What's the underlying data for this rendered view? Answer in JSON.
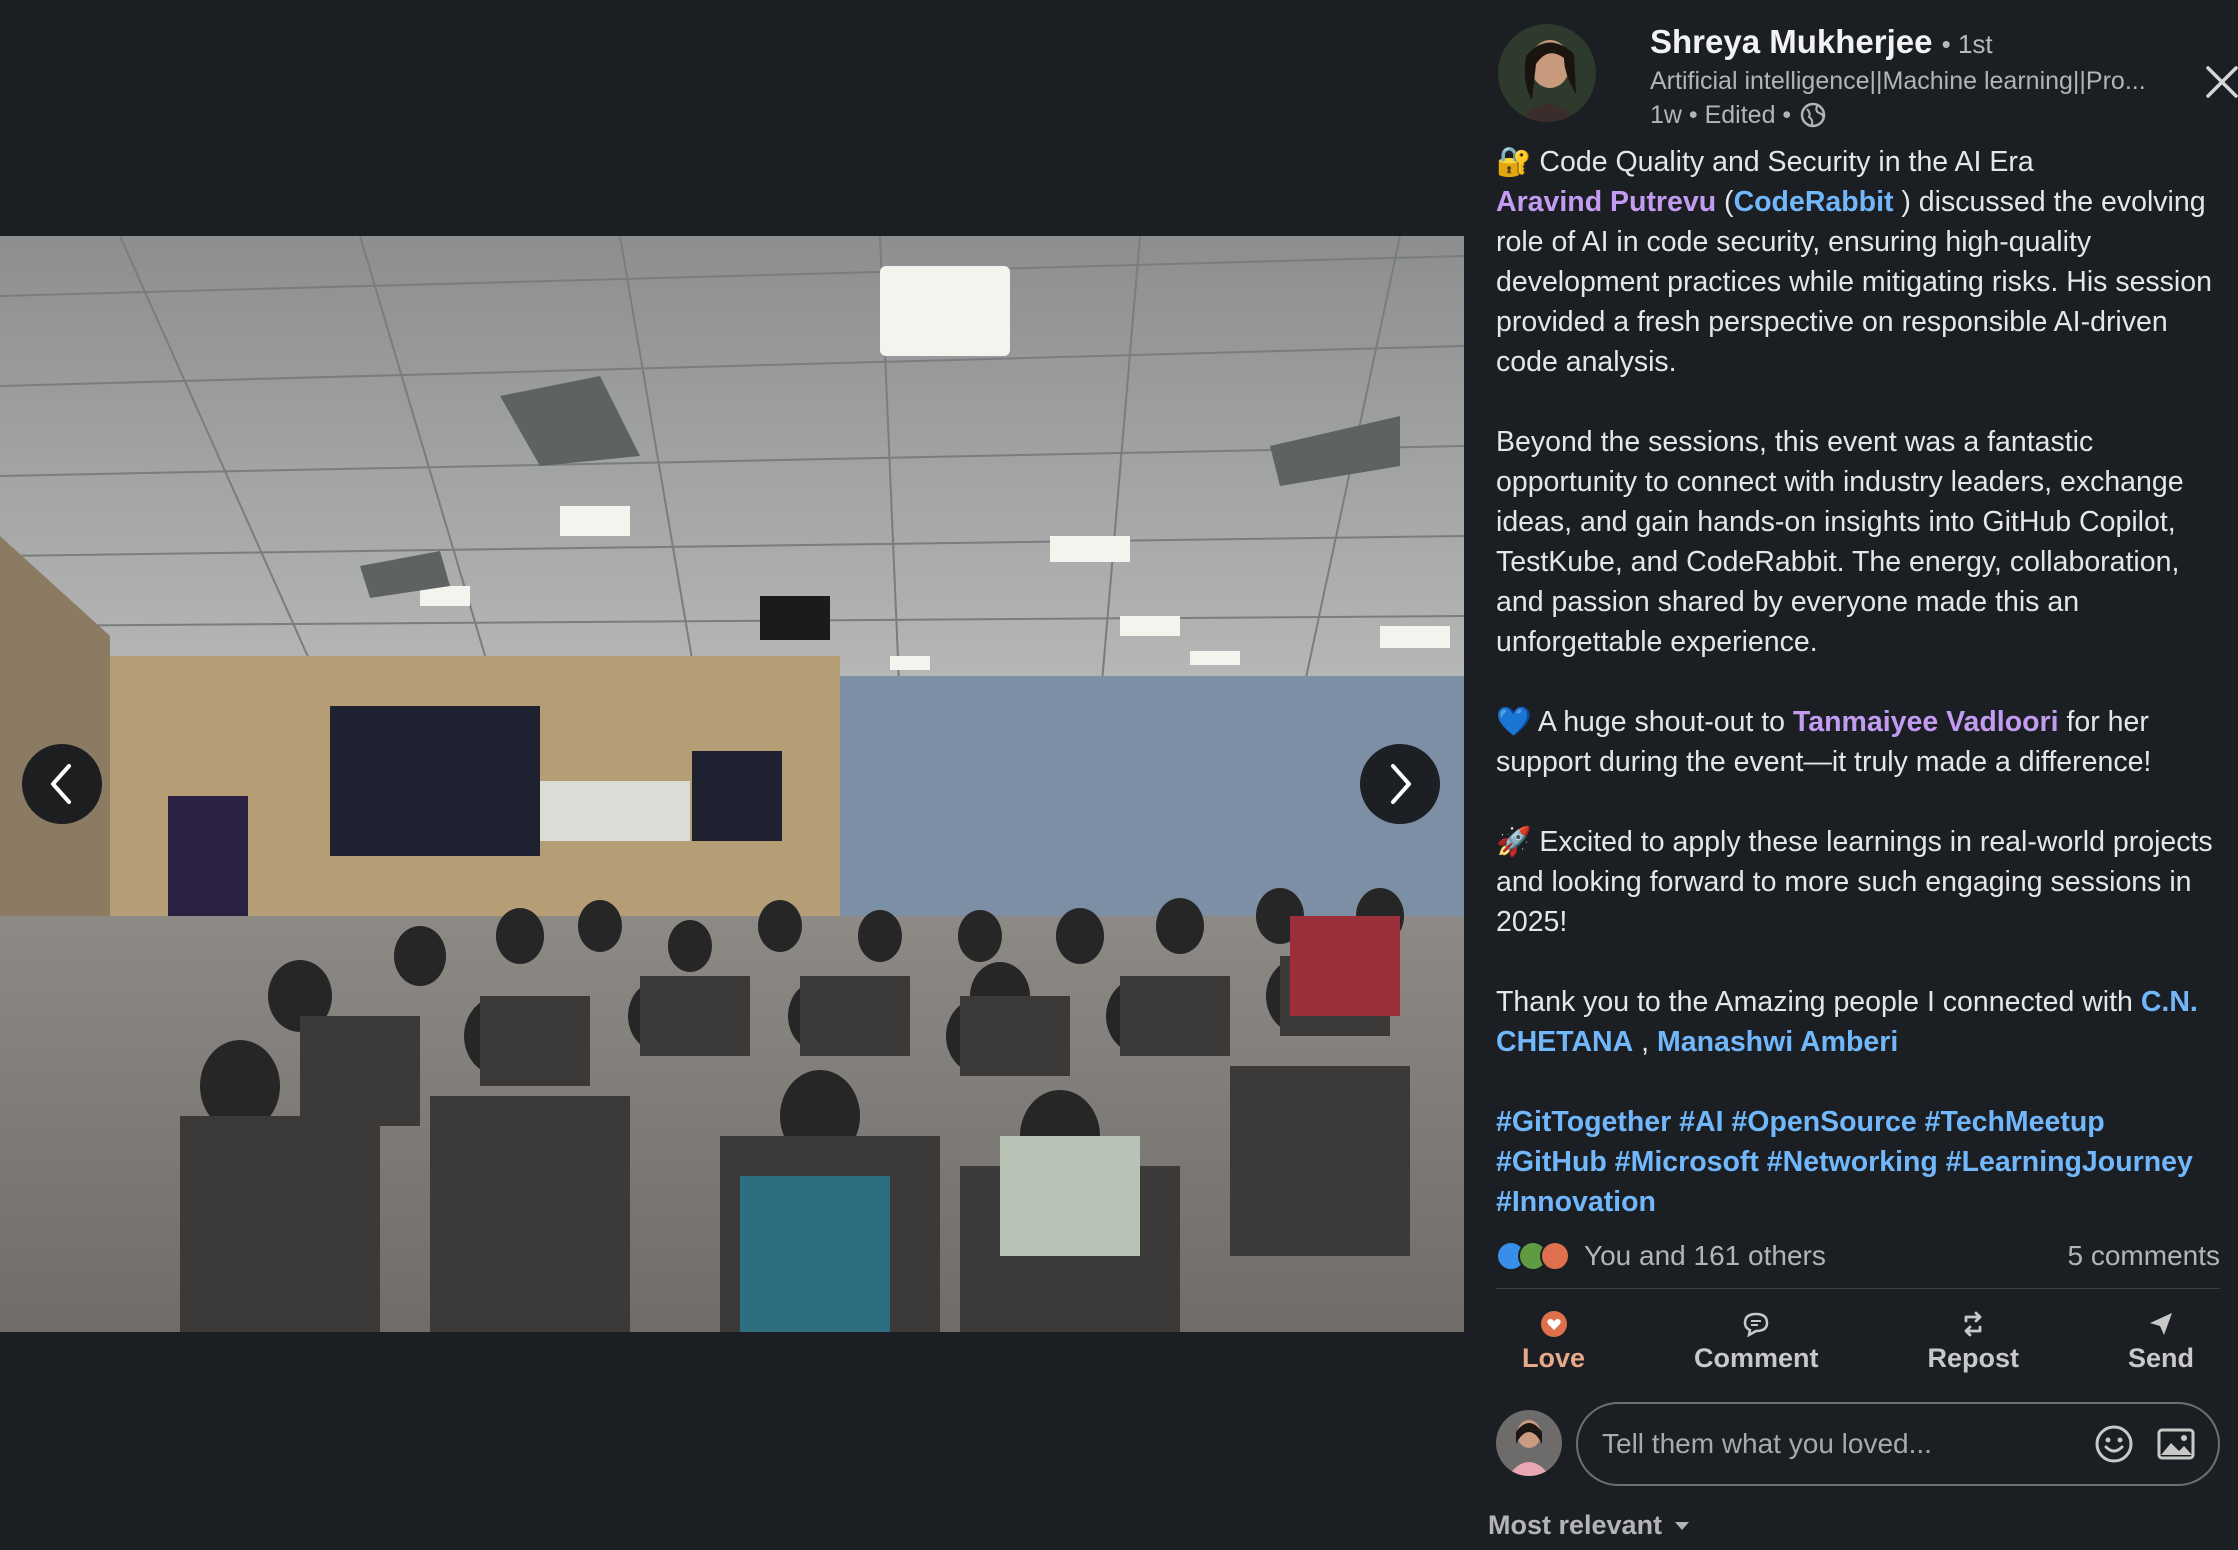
{
  "author": {
    "name": "Shreya Mukherjee",
    "degree": "• 1st",
    "headline": "Artificial intelligence||Machine learning||Pro...",
    "time": "1w • Edited •"
  },
  "post": {
    "p1_emoji": "🔐",
    "p1_title": " Code Quality and Security in the AI Era",
    "p1_mention1": "Aravind Putrevu",
    "p1_paren_open": " (",
    "p1_mention2": "CodeRabbit",
    "p1_rest": " ) discussed the evolving role of AI in code security, ensuring high-quality development practices while mitigating risks. His session provided a fresh perspective on responsible AI-driven code analysis.",
    "p2": "Beyond the sessions, this event was a fantastic opportunity to connect with industry leaders, exchange ideas, and gain hands-on insights into GitHub Copilot, TestKube, and CodeRabbit. The energy, collaboration, and passion shared by everyone made this an unforgettable experience.",
    "p3_emoji": "💙",
    "p3_before": " A huge shout-out to ",
    "p3_mention": "Tanmaiyee Vadloori",
    "p3_after": " for her support during the event—it truly made a difference!",
    "p4_emoji": "🚀",
    "p4_text": " Excited to apply these learnings in real-world projects and looking forward to more such engaging sessions in 2025!",
    "p5_before": "Thank you to the Amazing people I connected with ",
    "p5_mention1": "C.N. CHETANA",
    "p5_sep": " , ",
    "p5_mention2": "Manashwi Amberi",
    "hashtags": [
      "#GitTogether",
      "#AI",
      "#OpenSource",
      "#TechMeetup",
      "#GitHub",
      "#Microsoft",
      "#Networking",
      "#LearningJourney",
      "#Innovation"
    ]
  },
  "reactions": {
    "summary": "You and 161 others",
    "comments": "5 comments",
    "icons": [
      "like-icon",
      "celebrate-icon",
      "love-icon"
    ]
  },
  "actions": {
    "love": "Love",
    "comment": "Comment",
    "repost": "Repost",
    "send": "Send"
  },
  "comment_box": {
    "placeholder": "Tell them what you loved..."
  },
  "sort": {
    "label": "Most relevant"
  },
  "colors": {
    "background": "#1b1f23",
    "mention_purple": "#c39cf2",
    "link_blue": "#71b7fb",
    "love_active": "#e8a88c"
  }
}
